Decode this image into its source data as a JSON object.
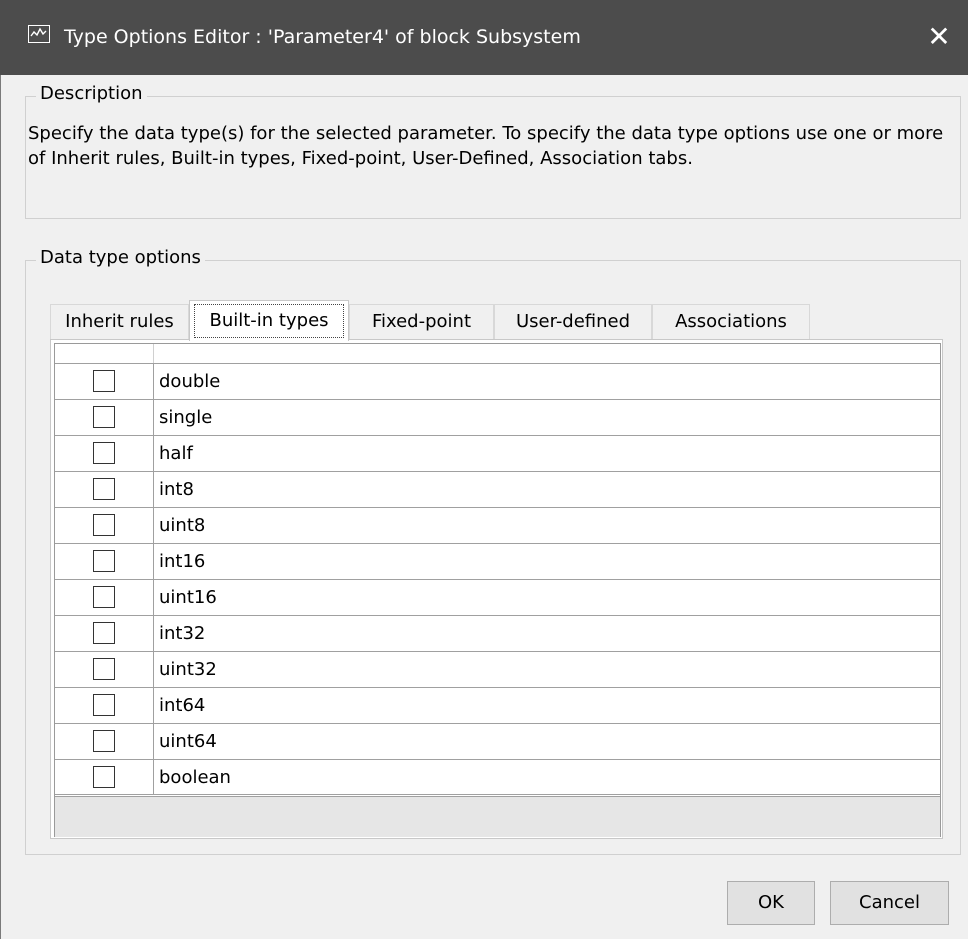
{
  "window": {
    "title": "Type Options Editor : 'Parameter4' of block Subsystem",
    "close_glyph": "✕"
  },
  "description": {
    "legend": "Description",
    "text": "Specify the data type(s) for the selected parameter. To specify the data type options use one or more of Inherit rules, Built-in types, Fixed-point, User-Defined, Association tabs."
  },
  "data_type_options": {
    "legend": "Data type options",
    "tabs": [
      {
        "label": "Inherit rules",
        "active": false
      },
      {
        "label": "Built-in types",
        "active": true
      },
      {
        "label": "Fixed-point",
        "active": false
      },
      {
        "label": "User-defined",
        "active": false
      },
      {
        "label": "Associations",
        "active": false
      }
    ],
    "types": [
      {
        "name": "double",
        "checked": false
      },
      {
        "name": "single",
        "checked": false
      },
      {
        "name": "half",
        "checked": false
      },
      {
        "name": "int8",
        "checked": false
      },
      {
        "name": "uint8",
        "checked": false
      },
      {
        "name": "int16",
        "checked": false
      },
      {
        "name": "uint16",
        "checked": false
      },
      {
        "name": "int32",
        "checked": false
      },
      {
        "name": "uint32",
        "checked": false
      },
      {
        "name": "int64",
        "checked": false
      },
      {
        "name": "uint64",
        "checked": false
      },
      {
        "name": "boolean",
        "checked": false
      }
    ]
  },
  "buttons": {
    "ok": "OK",
    "cancel": "Cancel"
  },
  "colors": {
    "titlebar": "#4c4c4c",
    "window_bg": "#f0f0f0"
  }
}
